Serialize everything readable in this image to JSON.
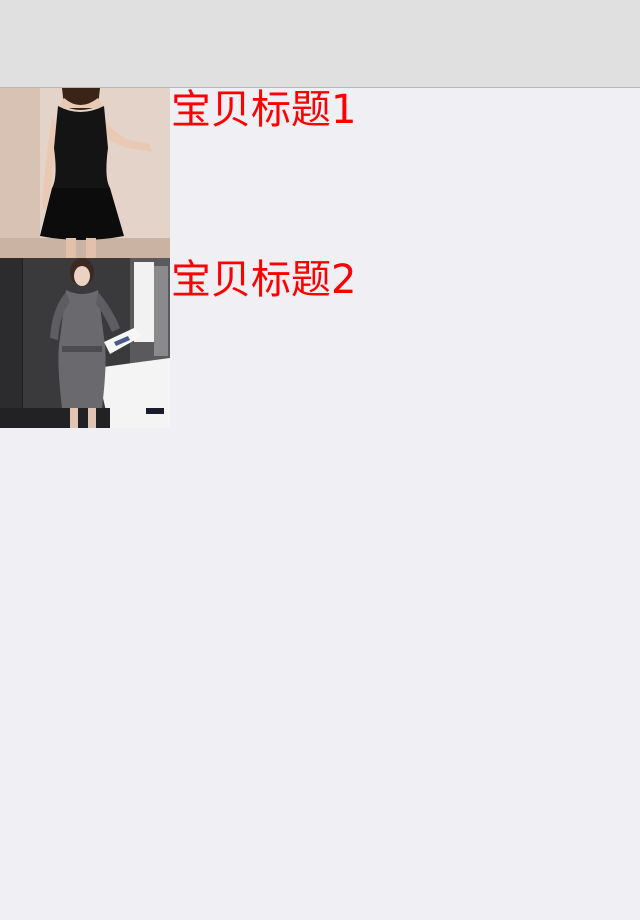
{
  "items": [
    {
      "title": "宝贝标题1",
      "image": "product-photo-black-sleeveless-dress"
    },
    {
      "title": "宝贝标题2",
      "image": "product-photo-gray-long-sleeve-dress"
    }
  ],
  "colors": {
    "title": "#ff0000",
    "background": "#efeff4",
    "nav_bar": "#e0e0e0"
  }
}
